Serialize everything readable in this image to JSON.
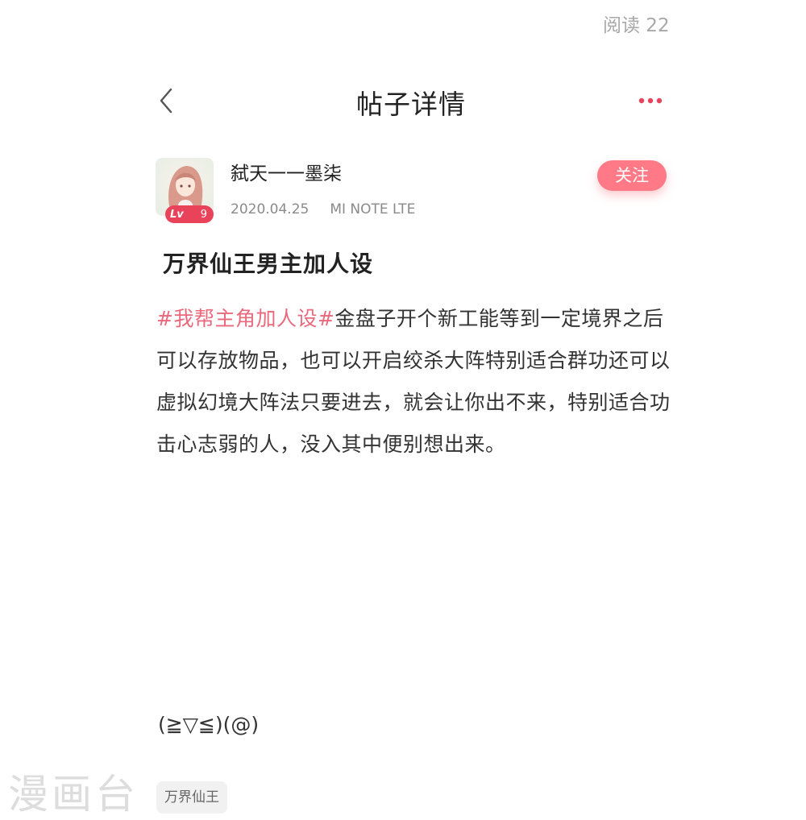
{
  "header": {
    "read_count": "阅读 22",
    "title": "帖子详情",
    "back_icon": "chevron-left-icon",
    "more_icon": "more-dots-icon"
  },
  "author": {
    "name": "弑天一一墨柒",
    "level_prefix": "Lv",
    "level": "9",
    "date": "2020.04.25",
    "device": "MI NOTE LTE",
    "follow_label": "关注"
  },
  "post": {
    "title": "万界仙王男主加人设",
    "topic_tag": "#我帮主角加人设#",
    "body": "金盘子开个新工能等到一定境界之后可以存放物品，也可以开启绞杀大阵特别适合群功还可以虚拟幻境大阵法只要进去，就会让你出不来，特别适合功击心志弱的人，没入其中便别想出来。",
    "emoticon": "(≧▽≦)(@)",
    "category_tag": "万界仙王"
  },
  "watermark": "漫画台",
  "colors": {
    "accent": "#e8435b",
    "follow_button": "#ff7a86",
    "topic": "#e86a7c",
    "muted": "#8a8a8a"
  }
}
